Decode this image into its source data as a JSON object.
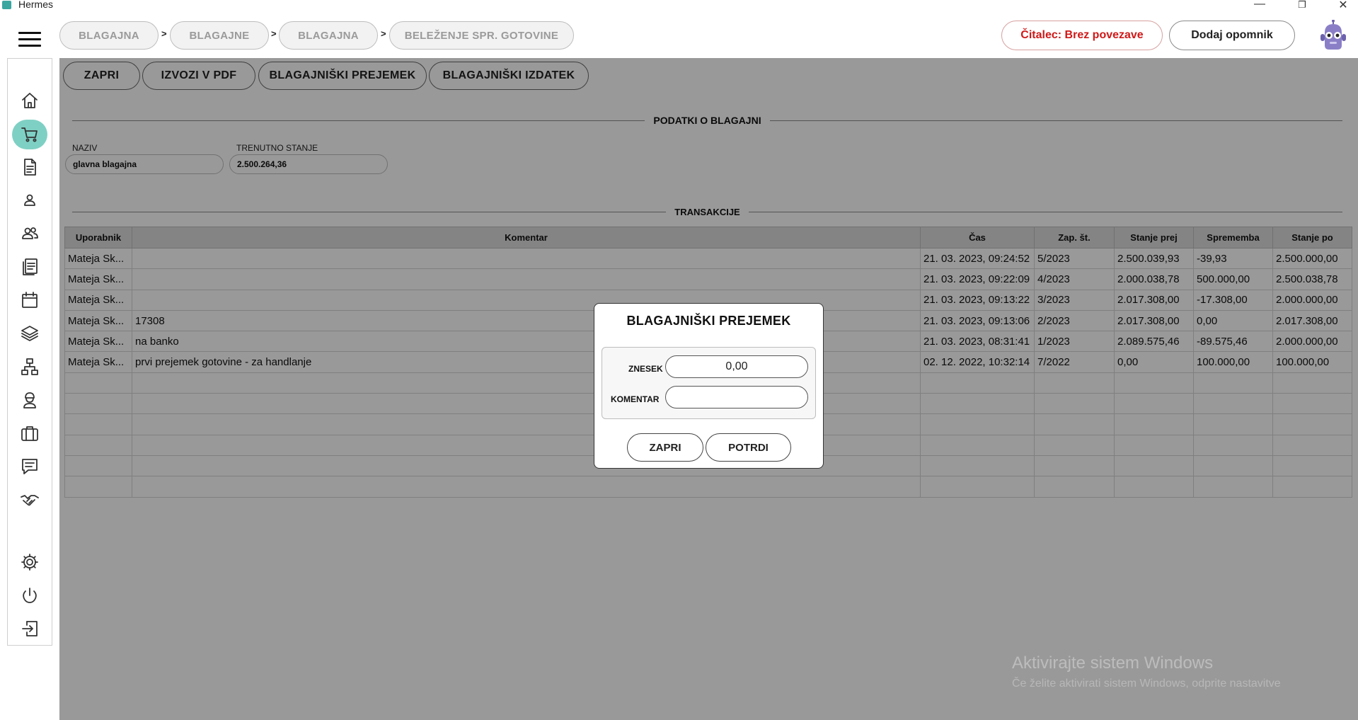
{
  "window": {
    "title": "Hermes",
    "minimize": "—",
    "restore": "❐",
    "close": "✕"
  },
  "breadcrumb": [
    {
      "label": "BLAGAJNA"
    },
    {
      "label": "BLAGAJNE"
    },
    {
      "label": "BLAGAJNA"
    },
    {
      "label": "BELEŽENJE SPR. GOTOVINE"
    }
  ],
  "breadcrumb_separator": ">",
  "header": {
    "reader_status": "Čitalec: Brez povezave",
    "add_reminder": "Dodaj opomnik"
  },
  "sidebar": {
    "items": [
      {
        "icon": "home-icon"
      },
      {
        "icon": "cart-icon",
        "active": true
      },
      {
        "icon": "document-icon"
      },
      {
        "icon": "user-icon"
      },
      {
        "icon": "users-icon"
      },
      {
        "icon": "list-document-icon"
      },
      {
        "icon": "calendar-icon"
      },
      {
        "icon": "layers-icon"
      },
      {
        "icon": "network-icon"
      },
      {
        "icon": "worker-icon"
      },
      {
        "icon": "briefcase-icon"
      },
      {
        "icon": "chat-icon"
      },
      {
        "icon": "handshake-icon"
      },
      {
        "icon": "settings-icon"
      },
      {
        "icon": "power-icon"
      },
      {
        "icon": "logout-icon"
      }
    ],
    "accent_color": "#7fd0c4"
  },
  "toolbar": {
    "close": "ZAPRI",
    "export_pdf": "IZVOZI V PDF",
    "receipt": "BLAGAJNIŠKI PREJEMEK",
    "issue": "BLAGAJNIŠKI IZDATEK"
  },
  "register_info": {
    "section_title": "PODATKI O BLAGAJNI",
    "name_label": "NAZIV",
    "name_value": "glavna blagajna",
    "balance_label": "TRENUTNO STANJE",
    "balance_value": "2.500.264,36"
  },
  "transactions": {
    "section_title": "TRANSAKCIJE",
    "columns": [
      "Uporabnik",
      "Komentar",
      "Čas",
      "Zap. št.",
      "Stanje prej",
      "Sprememba",
      "Stanje po"
    ],
    "rows": [
      [
        "Mateja Sk...",
        "",
        "21. 03. 2023, 09:24:52",
        "5/2023",
        "2.500.039,93",
        "-39,93",
        "2.500.000,00"
      ],
      [
        "Mateja Sk...",
        "",
        "21. 03. 2023, 09:22:09",
        "4/2023",
        "2.000.038,78",
        "500.000,00",
        "2.500.038,78"
      ],
      [
        "Mateja Sk...",
        "",
        "21. 03. 2023, 09:13:22",
        "3/2023",
        "2.017.308,00",
        "-17.308,00",
        "2.000.000,00"
      ],
      [
        "Mateja Sk...",
        "17308",
        "21. 03. 2023, 09:13:06",
        "2/2023",
        "2.017.308,00",
        "0,00",
        "2.017.308,00"
      ],
      [
        "Mateja Sk...",
        "na banko",
        "21. 03. 2023, 08:31:41",
        "1/2023",
        "2.089.575,46",
        "-89.575,46",
        "2.000.000,00"
      ],
      [
        "Mateja Sk...",
        "prvi prejemek gotovine - za handlanje",
        "02. 12. 2022, 10:32:14",
        "7/2022",
        "0,00",
        "100.000,00",
        "100.000,00"
      ]
    ]
  },
  "dialog": {
    "title": "BLAGAJNIŠKI PREJEMEK",
    "amount_label": "ZNESEK",
    "amount_value": "0,00",
    "comment_label": "KOMENTAR",
    "comment_value": "",
    "cancel": "ZAPRI",
    "confirm": "POTRDI"
  },
  "watermark": {
    "line1": "Aktivirajte sistem Windows",
    "line2": "Če želite aktivirati sistem Windows, odprite nastavitve"
  }
}
